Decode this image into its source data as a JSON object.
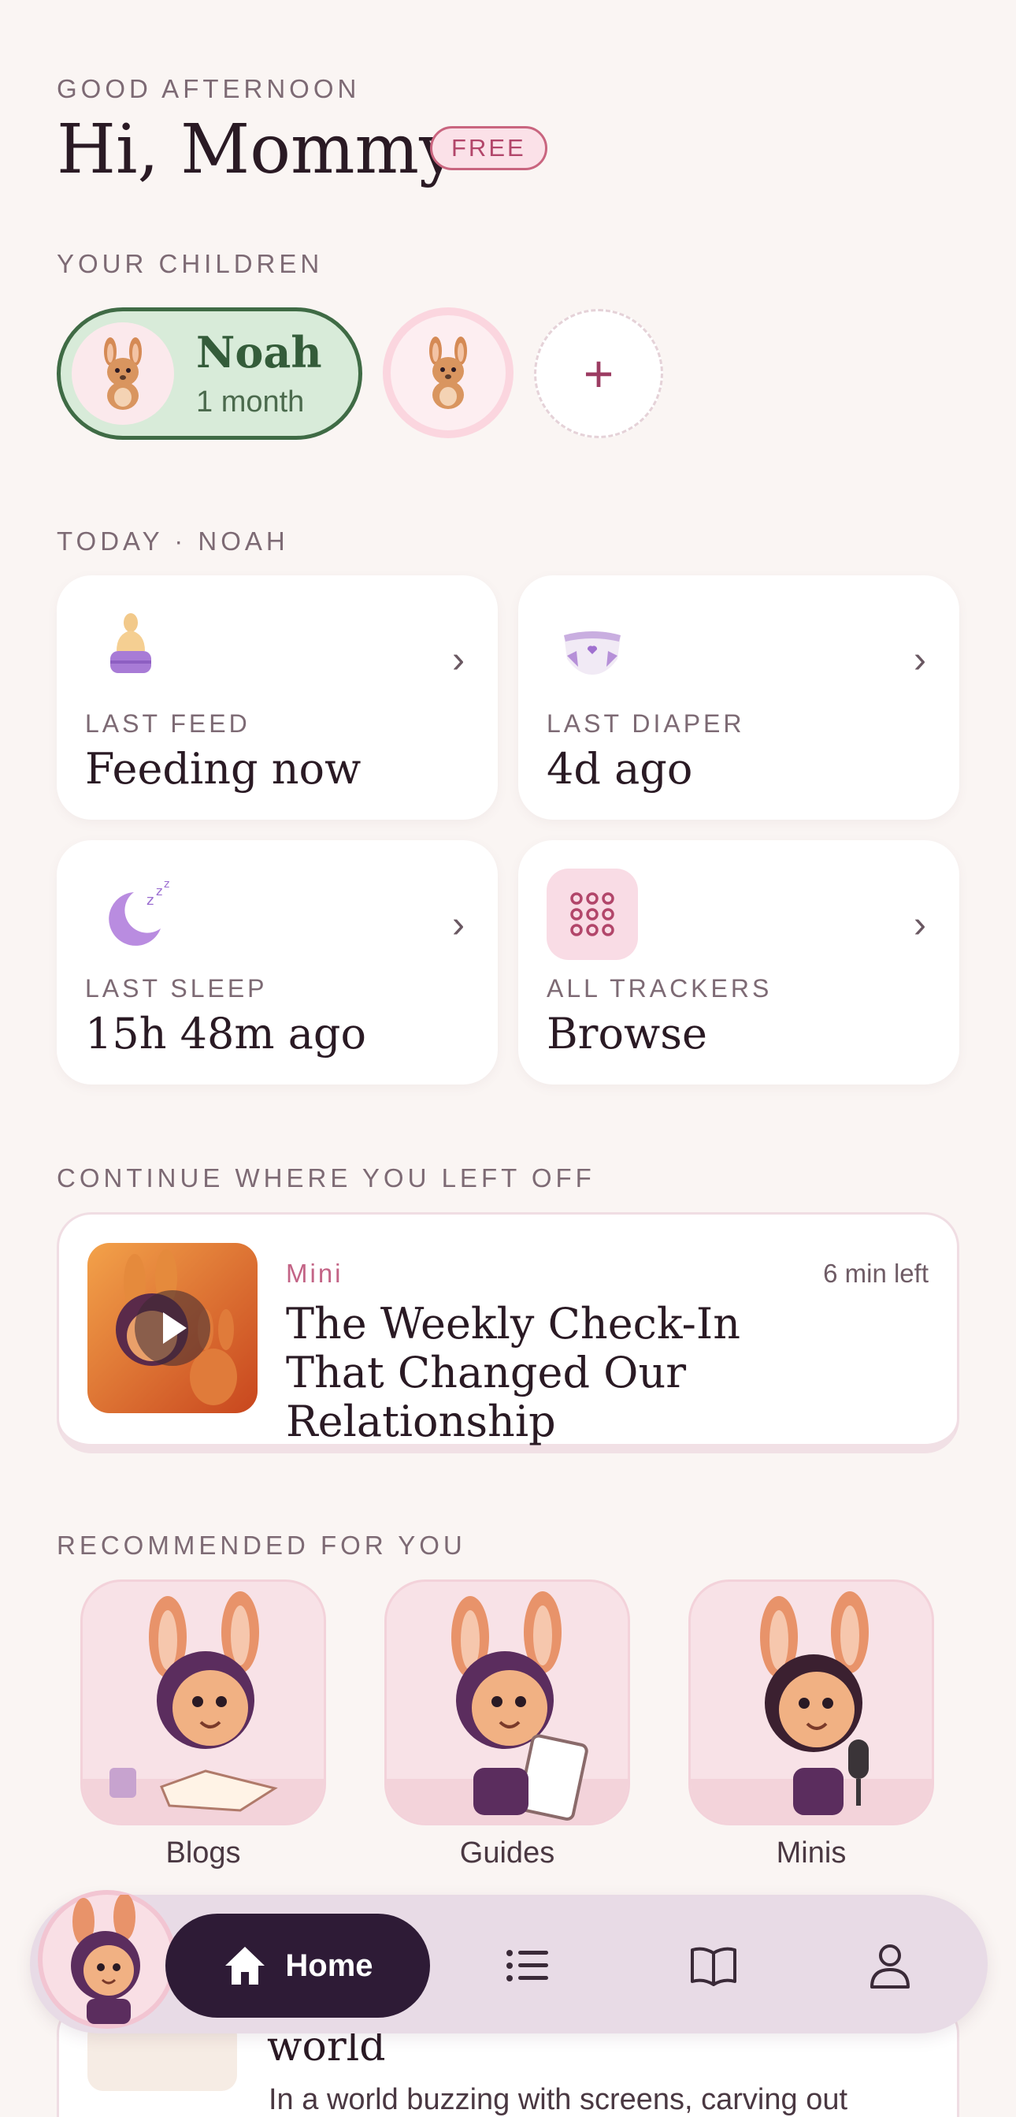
{
  "header": {
    "greeting": "GOOD AFTERNOON",
    "title": "Hi, Mommy",
    "plan_badge": "FREE"
  },
  "children": {
    "section_label": "YOUR CHILDREN",
    "selected": {
      "name": "Noah",
      "age": "1 month"
    },
    "add_symbol": "+"
  },
  "today": {
    "section_label": "TODAY · NOAH",
    "tiles": [
      {
        "label": "LAST FEED",
        "value": "Feeding now",
        "icon": "bottle-icon"
      },
      {
        "label": "LAST DIAPER",
        "value": "4d ago",
        "icon": "diaper-icon"
      },
      {
        "label": "LAST SLEEP",
        "value": "15h 48m ago",
        "icon": "moon-icon"
      },
      {
        "label": "ALL TRACKERS",
        "value": "Browse",
        "icon": "grid-icon"
      }
    ]
  },
  "continue": {
    "section_label": "CONTINUE WHERE YOU LEFT OFF",
    "tag": "Mini",
    "time_left": "6 min left",
    "title": "The Weekly Check-In That Changed Our Relationship"
  },
  "recommended": {
    "section_label": "RECOMMENDED FOR YOU",
    "items": [
      {
        "label": "Blogs"
      },
      {
        "label": "Guides"
      },
      {
        "label": "Minis"
      }
    ]
  },
  "peek": {
    "title": "world",
    "description": "In a world buzzing with screens, carving out"
  },
  "nav": {
    "home_label": "Home"
  },
  "colors": {
    "background": "#faf5f3",
    "accent_green": "#3f6b45",
    "accent_pink": "#c9657f",
    "nav_dark": "#2e1b36"
  }
}
